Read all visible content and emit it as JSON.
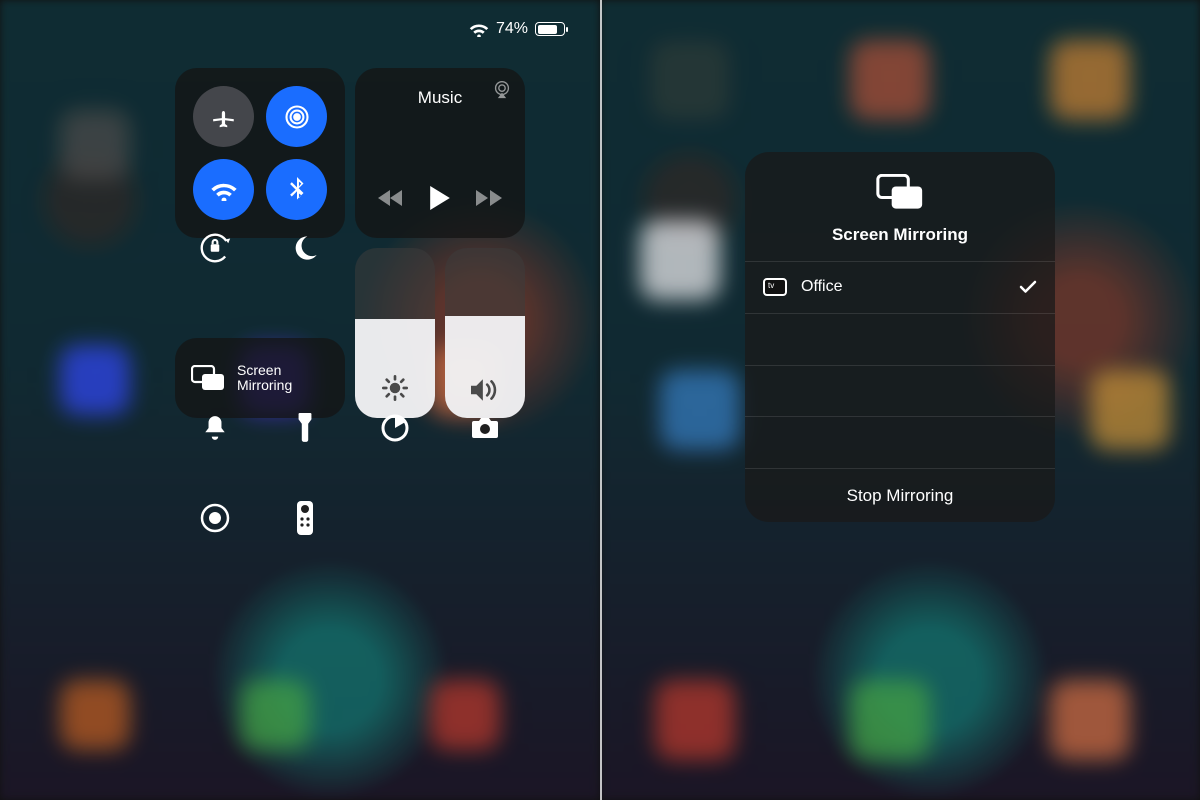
{
  "status": {
    "battery_percent": "74%",
    "battery_fill_pct": 74
  },
  "controlCenter": {
    "music": {
      "title": "Music"
    },
    "mirror": {
      "label": "Screen\nMirroring"
    },
    "brightness_pct": 58,
    "volume_pct": 60
  },
  "mirrorPanel": {
    "title": "Screen Mirroring",
    "device": "Office",
    "stop": "Stop Mirroring"
  }
}
